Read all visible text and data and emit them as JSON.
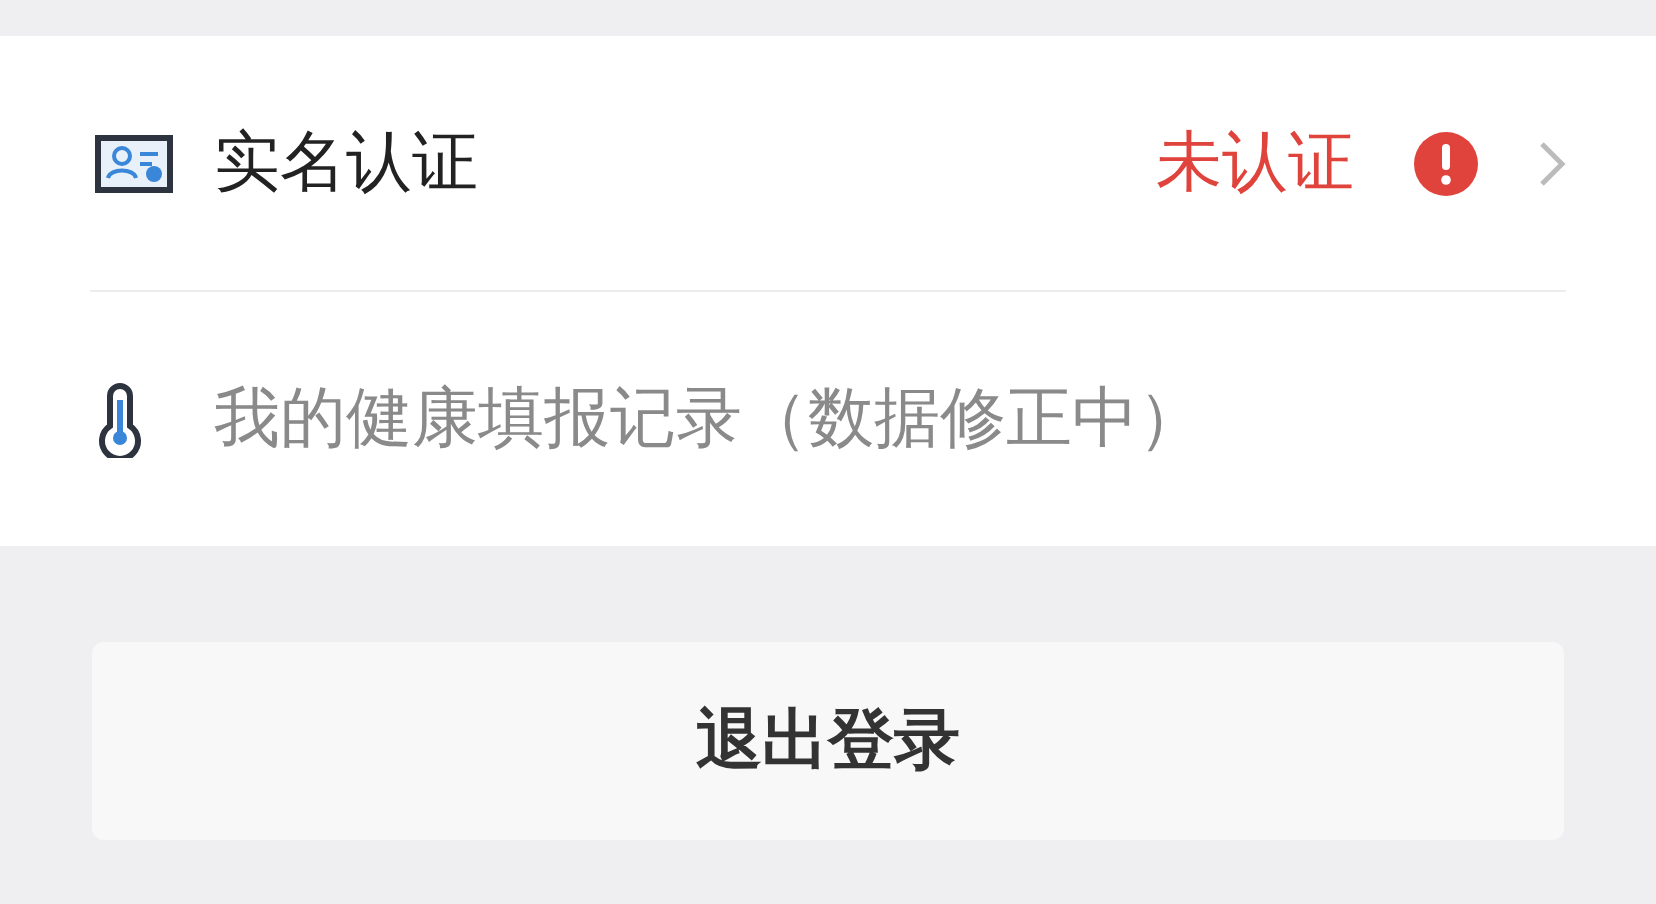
{
  "rows": [
    {
      "kind": "status",
      "label": "实名认证",
      "status": "未认证",
      "disabled": false
    },
    {
      "kind": "plain",
      "label": "我的健康填报记录（数据修正中）",
      "disabled": true
    }
  ],
  "logout_button": {
    "label": "退出登录"
  }
}
